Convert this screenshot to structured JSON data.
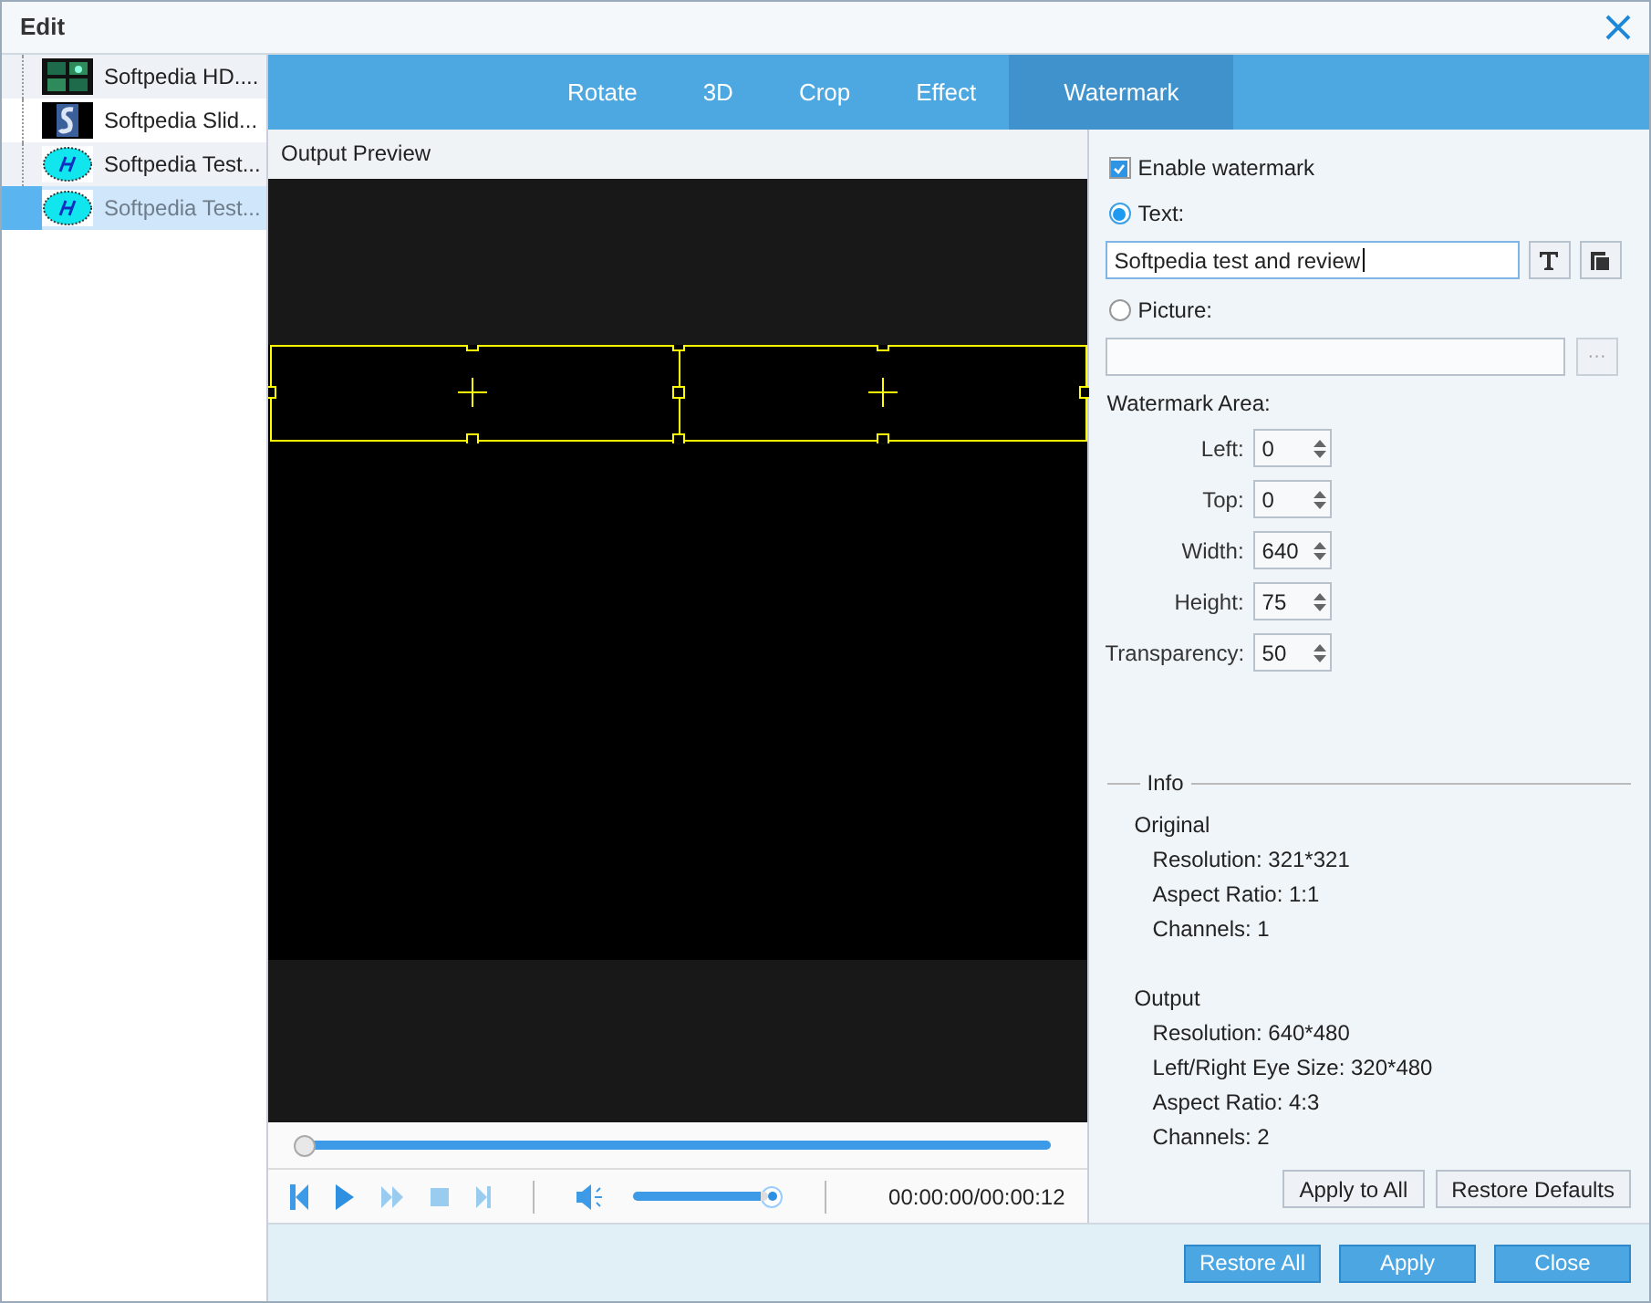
{
  "window": {
    "title": "Edit"
  },
  "files": [
    {
      "name": "Softpedia HD....",
      "selected": false
    },
    {
      "name": "Softpedia Slid...",
      "selected": false
    },
    {
      "name": "Softpedia Test...",
      "selected": false
    },
    {
      "name": "Softpedia Test...",
      "selected": true
    }
  ],
  "tabs": [
    {
      "label": "Rotate",
      "selected": false
    },
    {
      "label": "3D",
      "selected": false
    },
    {
      "label": "Crop",
      "selected": false
    },
    {
      "label": "Effect",
      "selected": false
    },
    {
      "label": "Watermark",
      "selected": true
    }
  ],
  "preview": {
    "title": "Output Preview",
    "seek": {
      "level": 0
    },
    "volume": {
      "level": 0.95
    },
    "time": "00:00:00/00:00:12"
  },
  "watermark": {
    "enable": {
      "label": "Enable watermark",
      "checked": true
    },
    "text_option": {
      "label": "Text:",
      "selected": true
    },
    "text_value": "Softpedia test and review",
    "picture_option": {
      "label": "Picture:",
      "selected": false
    },
    "area_title": "Watermark Area:",
    "fields": [
      {
        "label": "Left:",
        "value": "0"
      },
      {
        "label": "Top:",
        "value": "0"
      },
      {
        "label": "Width:",
        "value": "640"
      },
      {
        "label": "Height:",
        "value": "75"
      },
      {
        "label": "Transparency:",
        "value": "50"
      }
    ],
    "browse_button": "···"
  },
  "info": {
    "title": "Info",
    "groups": [
      {
        "title": "Original",
        "lines": [
          "Resolution: 321*321",
          "Aspect Ratio: 1:1",
          "Channels: 1"
        ]
      },
      {
        "title": "Output",
        "lines": [
          "Resolution: 640*480",
          "Left/Right Eye Size: 320*480",
          "Aspect Ratio: 4:3",
          "Channels: 2"
        ]
      }
    ]
  },
  "panel_buttons": [
    "Apply to All",
    "Restore Defaults"
  ],
  "footer_buttons": [
    "Restore All",
    "Apply",
    "Close"
  ]
}
